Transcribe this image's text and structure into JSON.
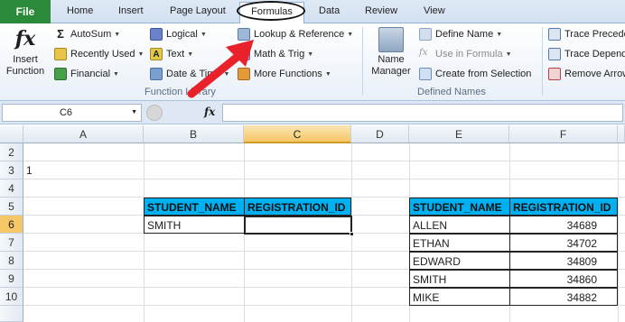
{
  "tabs": {
    "file": "File",
    "home": "Home",
    "insert": "Insert",
    "page_layout": "Page Layout",
    "formulas": "Formulas",
    "data": "Data",
    "review": "Review",
    "view": "View"
  },
  "ribbon": {
    "insert_function_line1": "Insert",
    "insert_function_line2": "Function",
    "autosum": "AutoSum",
    "recently_used": "Recently Used",
    "financial": "Financial",
    "logical": "Logical",
    "text": "Text",
    "date_time": "Date & Time",
    "lookup_reference": "Lookup & Reference",
    "math_trig": "Math & Trig",
    "more_functions": "More Functions",
    "function_library_label": "Function Library",
    "name_manager_line1": "Name",
    "name_manager_line2": "Manager",
    "define_name": "Define Name",
    "use_in_formula": "Use in Formula",
    "create_from_selection": "Create from Selection",
    "defined_names_label": "Defined Names",
    "trace_precedents": "Trace Precedents",
    "trace_dependents": "Trace Dependents",
    "remove_arrows": "Remove Arrows"
  },
  "formula_bar": {
    "name_box": "C6",
    "fx_label": "fx",
    "formula": ""
  },
  "grid": {
    "columns": [
      "A",
      "B",
      "C",
      "D",
      "E",
      "F"
    ],
    "rows": [
      "2",
      "3",
      "4",
      "5",
      "6",
      "7",
      "8",
      "9",
      "10"
    ],
    "a3_value": "1",
    "left_table": {
      "headers": [
        "STUDENT_NAME",
        "REGISTRATION_ID"
      ],
      "row": [
        "SMITH",
        ""
      ]
    },
    "right_table": {
      "headers": [
        "STUDENT_NAME",
        "REGISTRATION_ID"
      ],
      "rows": [
        [
          "ALLEN",
          "34689"
        ],
        [
          "ETHAN",
          "34702"
        ],
        [
          "EDWARD",
          "34809"
        ],
        [
          "SMITH",
          "34860"
        ],
        [
          "MIKE",
          "34882"
        ]
      ]
    }
  },
  "colors": {
    "file_tab": "#2a8a3a",
    "table_header": "#00b0f0",
    "selected_header": "#f6c766",
    "arrow": "#e8212a"
  }
}
